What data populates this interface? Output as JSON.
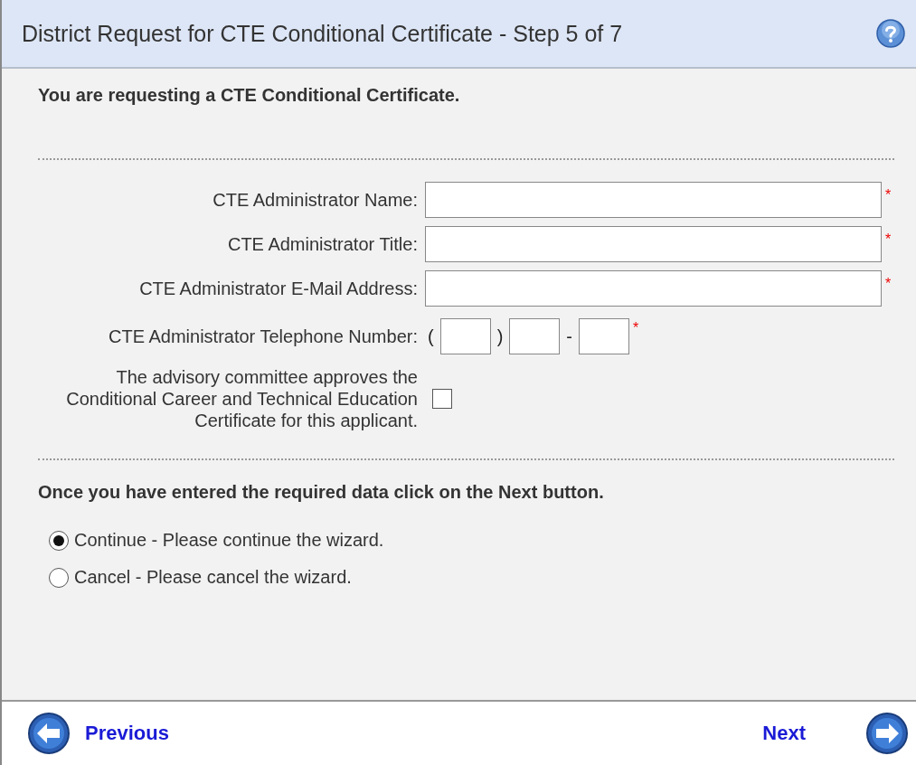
{
  "window": {
    "title": "District Request for CTE Conditional Certificate - Step 5 of 7"
  },
  "intro": "You are requesting a CTE Conditional Certificate.",
  "fields": [
    {
      "kind": "text",
      "label": "CTE Administrator Name:",
      "required_mark": "*"
    },
    {
      "kind": "text",
      "label": "CTE Administrator Title:",
      "required_mark": "*"
    },
    {
      "kind": "text",
      "label": "CTE Administrator E-Mail Address:",
      "required_mark": "*"
    },
    {
      "kind": "phone",
      "label": "CTE Administrator Telephone Number:",
      "open_paren": "(",
      "close_paren": ")",
      "dash": "-",
      "required_mark": "*"
    },
    {
      "kind": "checkbox",
      "label": "The advisory committee approves the Conditional Career and Technical Education Certificate for this applicant.",
      "checked": false
    }
  ],
  "instruction": "Once you have entered the required data click on the Next button.",
  "options": [
    {
      "label": "Continue - Please continue the wizard.",
      "selected": true
    },
    {
      "label": "Cancel - Please cancel the wizard.",
      "selected": false
    }
  ],
  "nav": {
    "previous": "Previous",
    "next": "Next"
  }
}
